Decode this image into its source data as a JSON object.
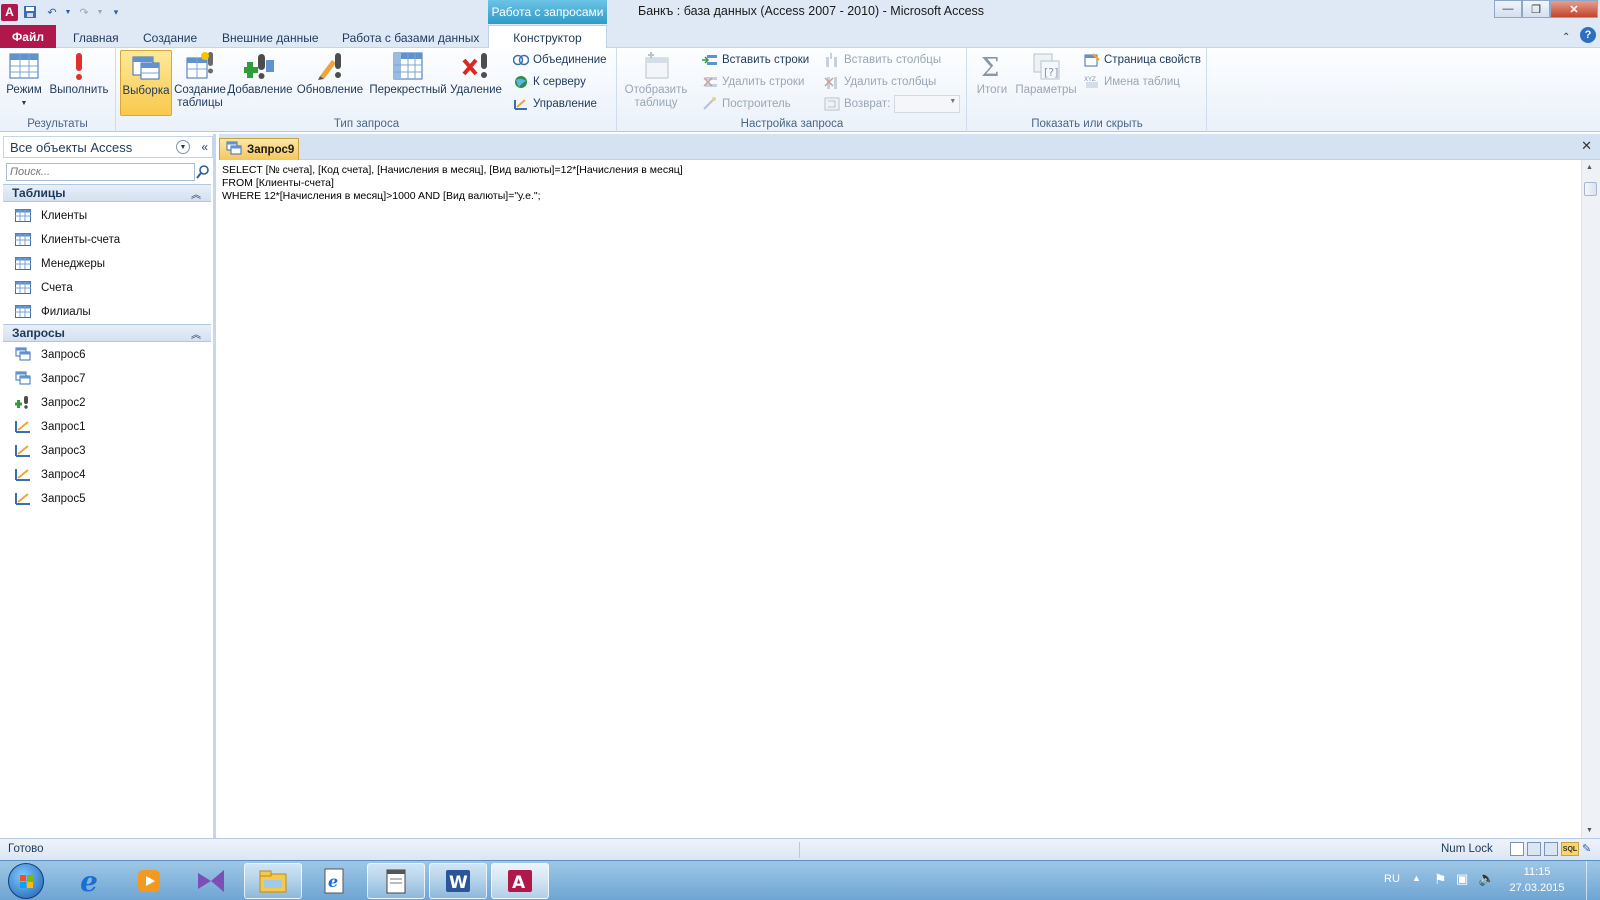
{
  "window": {
    "title": "Банкъ : база данных (Access 2007 - 2010)  -  Microsoft Access",
    "context_tab_group": "Работа с запросами",
    "app_icon_letter": "A"
  },
  "ribbon_tabs": {
    "file": "Файл",
    "home": "Главная",
    "create": "Создание",
    "external": "Внешние данные",
    "dbtools": "Работа с базами данных",
    "design": "Конструктор"
  },
  "ribbon": {
    "results": {
      "label": "Результаты",
      "mode": "Режим",
      "run": "Выполнить"
    },
    "query_type": {
      "label": "Тип запроса",
      "select": "Выборка",
      "make_table_1": "Создание",
      "make_table_2": "таблицы",
      "append": "Добавление",
      "update": "Обновление",
      "crosstab": "Перекрестный",
      "delete": "Удаление",
      "union": "Объединение",
      "passthrough": "К серверу",
      "data_def": "Управление"
    },
    "query_setup": {
      "label": "Настройка запроса",
      "show_table_1": "Отобразить",
      "show_table_2": "таблицу",
      "insert_rows": "Вставить строки",
      "delete_rows": "Удалить строки",
      "builder": "Построитель",
      "insert_columns": "Вставить столбцы",
      "delete_columns": "Удалить столбцы",
      "return": "Возврат:",
      "return_value": ""
    },
    "show_hide": {
      "label": "Показать или скрыть",
      "totals": "Итоги",
      "parameters": "Параметры",
      "property_sheet": "Страница свойств",
      "table_names": "Имена таблиц"
    }
  },
  "nav_pane": {
    "header": "Все объекты Access",
    "search_placeholder": "Поиск...",
    "tables_header": "Таблицы",
    "tables": [
      "Клиенты",
      "Клиенты-счета",
      "Менеджеры",
      "Счета",
      "Филиалы"
    ],
    "queries_header": "Запросы",
    "queries": [
      "Запрос6",
      "Запрос7",
      "Запрос2",
      "Запрос1",
      "Запрос3",
      "Запрос4",
      "Запрос5"
    ]
  },
  "document": {
    "tab_title": "Запрос9",
    "sql_lines": [
      "SELECT [№ счета], [Код счета], [Начисления в месяц], [Вид валюты]=12*[Начисления в месяц]",
      "FROM [Клиенты-счета]",
      "WHERE 12*[Начисления в месяц]>1000 AND [Вид валюты]=\"у.е.\";"
    ]
  },
  "statusbar": {
    "left": "Готово",
    "num_lock": "Num Lock"
  },
  "taskbar": {
    "language": "RU",
    "time": "11:15",
    "date": "27.03.2015"
  },
  "colors": {
    "file_tab": "#b0174b",
    "context_tab": "#2f9ac7",
    "doc_tab": "#f6c75b"
  }
}
